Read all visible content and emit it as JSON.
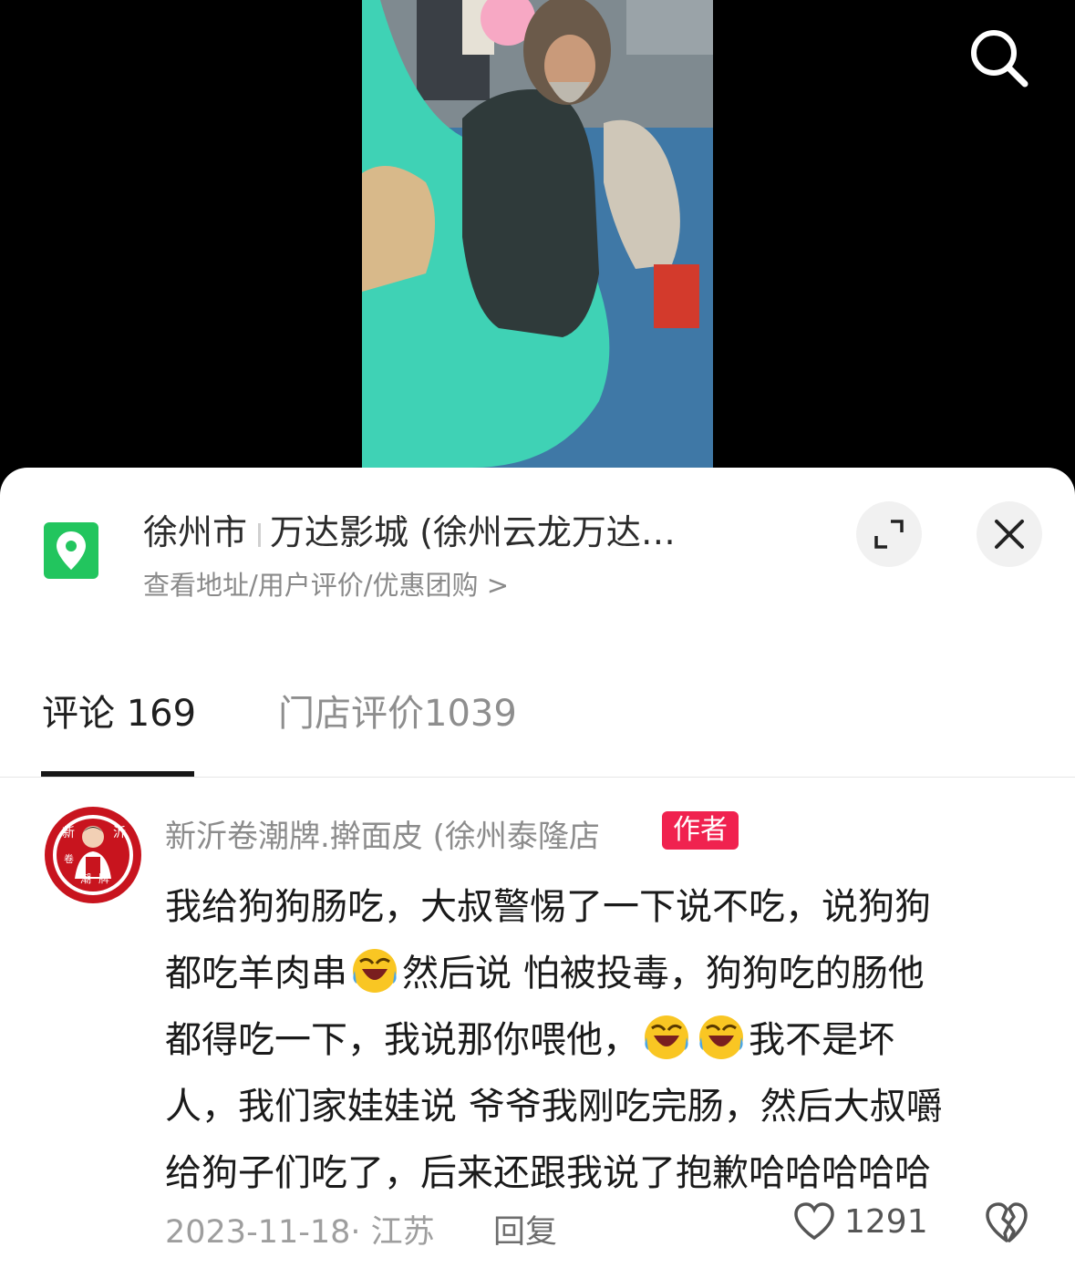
{
  "poi": {
    "city": "徐州市",
    "name": "万达影城 (徐州云龙万达…",
    "subtitle": "查看地址/用户评价/优惠团购 >"
  },
  "tabs": [
    {
      "label": "评论 169",
      "active": true
    },
    {
      "label": "门店评价1039",
      "active": false
    }
  ],
  "comment": {
    "username": "新沂卷潮牌.擀面皮 (徐州泰隆店",
    "badge": "作者",
    "avatar_text": [
      "新",
      "沂",
      "卷",
      "潮",
      "牌"
    ],
    "line1": "我给狗狗肠吃，大叔警惕了一下说不吃，说狗狗",
    "line2a": "都吃羊肉串",
    "line2b": "然后说 怕被投毒，狗狗吃的肠他",
    "line3a": "都得吃一下，我说那你喂他，",
    "line3b": "我不是坏",
    "line4": "人，我们家娃娃说 爷爷我刚吃完肠，然后大叔嚼",
    "line5": "给狗子们吃了，后来还跟我说了抱歉哈哈哈哈哈",
    "date_location": "2023-11-18· 江苏",
    "reply_label": "回复",
    "likes": "1291"
  },
  "colors": {
    "accent_badge": "#f0224f",
    "pin_green": "#22c55e"
  }
}
